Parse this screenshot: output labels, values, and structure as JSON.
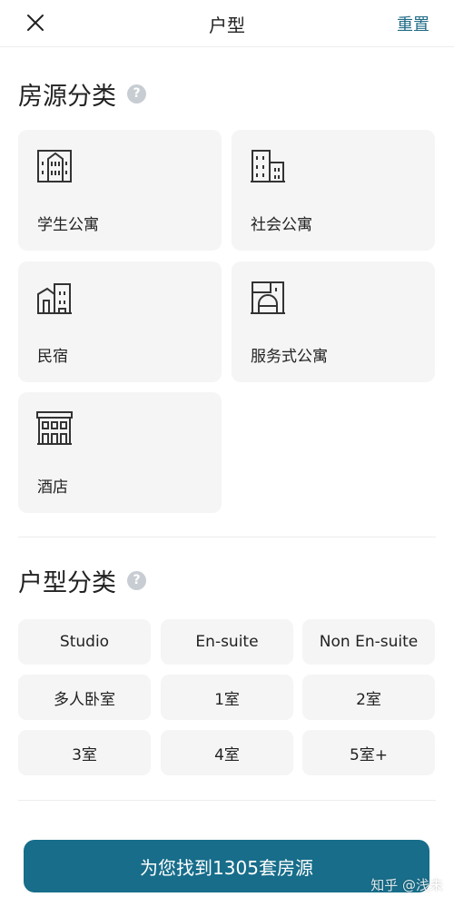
{
  "header": {
    "title": "户型",
    "reset_label": "重置"
  },
  "property_section": {
    "title": "房源分类",
    "help_icon": "?",
    "cards": [
      {
        "label": "学生公寓",
        "icon": "student-apartment-icon"
      },
      {
        "label": "社会公寓",
        "icon": "apartment-building-icon"
      },
      {
        "label": "民宿",
        "icon": "homestay-icon"
      },
      {
        "label": "服务式公寓",
        "icon": "serviced-apartment-icon"
      },
      {
        "label": "酒店",
        "icon": "hotel-icon"
      }
    ]
  },
  "room_section": {
    "title": "户型分类",
    "help_icon": "?",
    "chips": [
      "Studio",
      "En-suite",
      "Non En-suite",
      "多人卧室",
      "1室",
      "2室",
      "3室",
      "4室",
      "5室+"
    ]
  },
  "cta": {
    "label": "为您找到1305套房源"
  },
  "watermark": "知乎 @浅未",
  "colors": {
    "accent": "#176d8a",
    "reset_text": "#1f6b85",
    "card_bg": "#f5f5f5",
    "help_icon_bg": "#c7cdd2"
  }
}
